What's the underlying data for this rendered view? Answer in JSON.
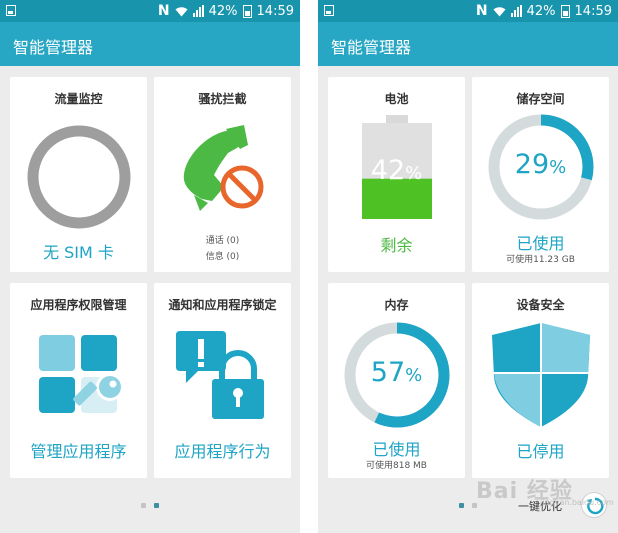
{
  "status_bar": {
    "battery_percent": "42%",
    "time": "14:59",
    "network_glyph": "N"
  },
  "app": {
    "title": "智能管理器"
  },
  "screen1": {
    "data_monitor": {
      "title": "流量监控",
      "label": "无 SIM 卡",
      "ring_color": "#9e9e9e"
    },
    "call_block": {
      "title": "骚扰拦截",
      "calls_text": "通话 (0)",
      "messages_text": "信息 (0)",
      "phone_color": "#4cb944",
      "block_color": "#e8652b"
    },
    "app_permissions": {
      "title": "应用程序权限管理",
      "label": "管理应用程序"
    },
    "app_lock": {
      "title": "通知和应用程序锁定",
      "label": "应用程序行为"
    },
    "page_indicator": {
      "count": 2,
      "active": 1
    }
  },
  "screen2": {
    "battery": {
      "title": "电池",
      "value": "42",
      "unit": "%",
      "label": "剩余",
      "level": 0.42,
      "fill_color": "#4ec224"
    },
    "storage": {
      "title": "储存空间",
      "value": "29",
      "unit": "%",
      "label": "已使用",
      "sub": "可使用11.23 GB",
      "fraction": 0.29
    },
    "memory": {
      "title": "内存",
      "value": "57",
      "unit": "%",
      "label": "已使用",
      "sub": "可使用818 MB",
      "fraction": 0.57
    },
    "security": {
      "title": "设备安全",
      "label": "已停用"
    },
    "page_indicator": {
      "count": 2,
      "active": 0
    },
    "optimize_label": "一键优化"
  },
  "watermark": {
    "text": "Bai 经验",
    "sub": "jingyan.baidu.com"
  },
  "colors": {
    "accent": "#1ea4c5",
    "appbar": "#27a7c4",
    "statusbar": "#1895ad",
    "gauge_track": "#d4dbdd"
  }
}
